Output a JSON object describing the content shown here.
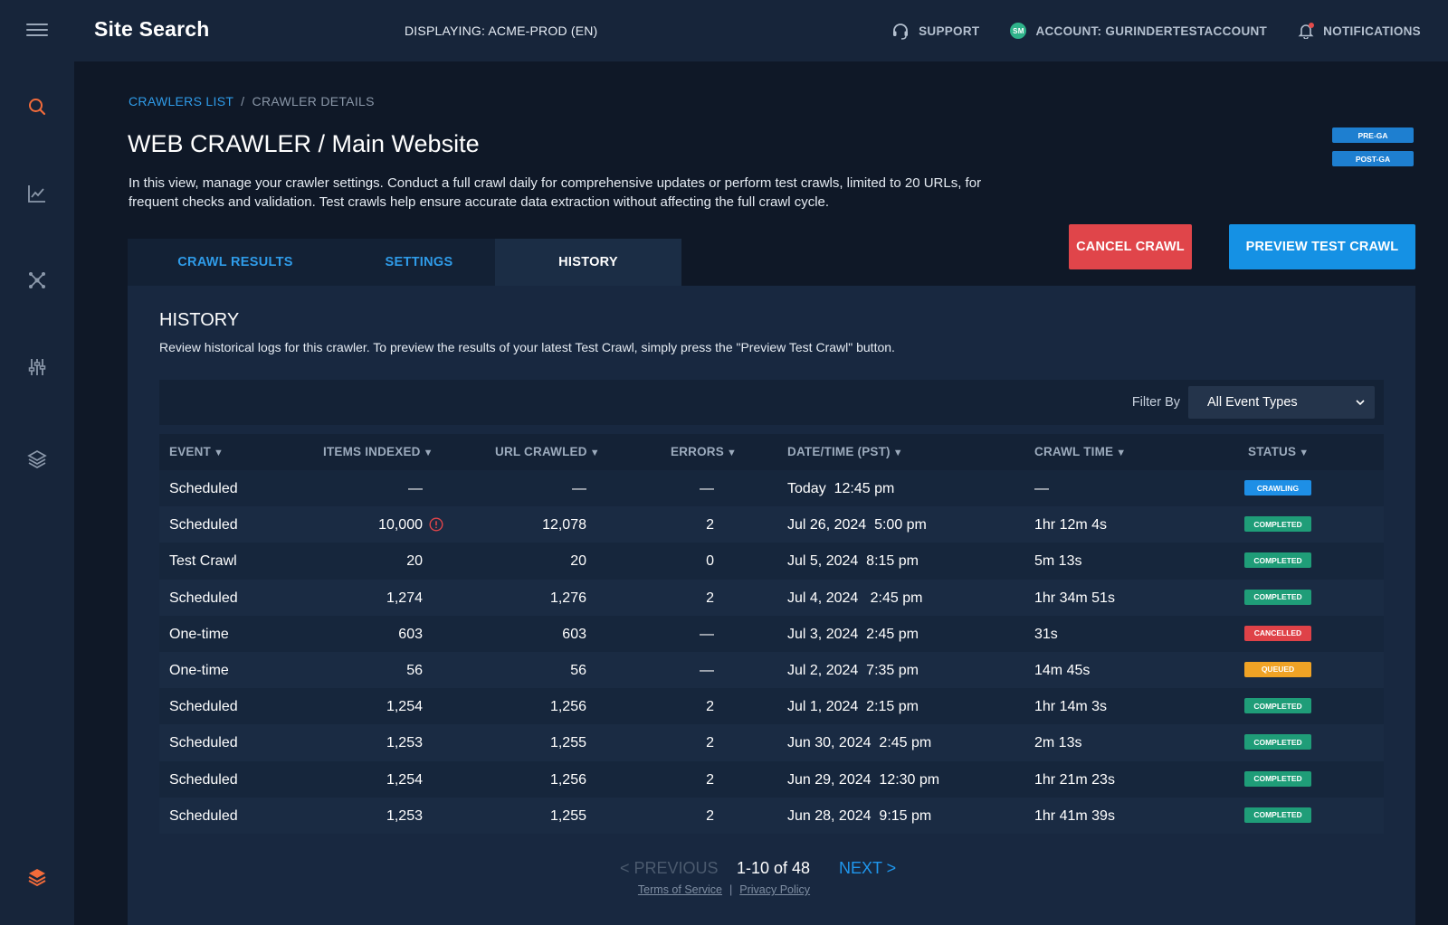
{
  "app": {
    "title": "Site Search",
    "displaying": "DISPLAYING: ACME-PROD (EN)"
  },
  "topnav": {
    "support": "SUPPORT",
    "account_initials": "SM",
    "account": "ACCOUNT: GURINDERTESTACCOUNT",
    "notifications": "NOTIFICATIONS"
  },
  "breadcrumb": {
    "link": "CRAWLERS LIST",
    "sep": "/",
    "current": "CRAWLER DETAILS"
  },
  "page": {
    "title": "WEB CRAWLER / Main Website",
    "description": "In this view, manage your crawler settings. Conduct a full crawl daily for comprehensive updates or perform test crawls, limited to 20 URLs, for frequent checks and validation. Test crawls help ensure accurate data extraction without affecting the full crawl cycle."
  },
  "badges": {
    "pre_ga": "PRE-GA",
    "post_ga": "POST-GA"
  },
  "actions": {
    "cancel": "CANCEL CRAWL",
    "preview": "PREVIEW TEST CRAWL"
  },
  "tabs": [
    {
      "label": "CRAWL RESULTS",
      "active": false
    },
    {
      "label": "SETTINGS",
      "active": false
    },
    {
      "label": "HISTORY",
      "active": true
    }
  ],
  "history": {
    "title": "HISTORY",
    "description": "Review historical logs for this crawler. To preview the results of your latest Test Crawl, simply press the \"Preview Test Crawl\" button.",
    "filter_label": "Filter By",
    "filter_value": "All Event Types"
  },
  "columns": {
    "event": "EVENT",
    "items_indexed": "ITEMS INDEXED",
    "url_crawled": "URL CRAWLED",
    "errors": "ERRORS",
    "datetime": "DATE/TIME (PST)",
    "crawl_time": "CRAWL TIME",
    "status": "STATUS",
    "sort_arrow": "▼"
  },
  "rows": [
    {
      "event": "Scheduled",
      "items": "—",
      "urls": "—",
      "errors": "—",
      "datetime": "Today  12:45 pm",
      "crawl_time": "—",
      "status": "CRAWLING",
      "status_color": "#1e8fe6",
      "warning": false
    },
    {
      "event": "Scheduled",
      "items": "10,000",
      "urls": "12,078",
      "errors": "2",
      "datetime": "Jul 26, 2024  5:00 pm",
      "crawl_time": "1hr 12m 4s",
      "status": "COMPLETED",
      "status_color": "#1f9d78",
      "warning": true
    },
    {
      "event": "Test Crawl",
      "items": "20",
      "urls": "20",
      "errors": "0",
      "datetime": "Jul 5, 2024  8:15 pm",
      "crawl_time": "5m 13s",
      "status": "COMPLETED",
      "status_color": "#1f9d78",
      "warning": false
    },
    {
      "event": "Scheduled",
      "items": "1,274",
      "urls": "1,276",
      "errors": "2",
      "datetime": "Jul 4, 2024   2:45 pm",
      "crawl_time": "1hr 34m 51s",
      "status": "COMPLETED",
      "status_color": "#1f9d78",
      "warning": false
    },
    {
      "event": "One-time",
      "items": "603",
      "urls": "603",
      "errors": "—",
      "datetime": "Jul 3, 2024  2:45 pm",
      "crawl_time": "31s",
      "status": "CANCELLED",
      "status_color": "#df4248",
      "warning": false
    },
    {
      "event": "One-time",
      "items": "56",
      "urls": "56",
      "errors": "—",
      "datetime": "Jul 2, 2024  7:35 pm",
      "crawl_time": "14m 45s",
      "status": "QUEUED",
      "status_color": "#f0a325",
      "warning": false
    },
    {
      "event": "Scheduled",
      "items": "1,254",
      "urls": "1,256",
      "errors": "2",
      "datetime": "Jul 1, 2024  2:15 pm",
      "crawl_time": "1hr 14m 3s",
      "status": "COMPLETED",
      "status_color": "#1f9d78",
      "warning": false
    },
    {
      "event": "Scheduled",
      "items": "1,253",
      "urls": "1,255",
      "errors": "2",
      "datetime": "Jun 30, 2024  2:45 pm",
      "crawl_time": "2m 13s",
      "status": "COMPLETED",
      "status_color": "#1f9d78",
      "warning": false
    },
    {
      "event": "Scheduled",
      "items": "1,254",
      "urls": "1,256",
      "errors": "2",
      "datetime": "Jun 29, 2024  12:30 pm",
      "crawl_time": "1hr 21m 23s",
      "status": "COMPLETED",
      "status_color": "#1f9d78",
      "warning": false
    },
    {
      "event": "Scheduled",
      "items": "1,253",
      "urls": "1,255",
      "errors": "2",
      "datetime": "Jun 28, 2024  9:15 pm",
      "crawl_time": "1hr 41m 39s",
      "status": "COMPLETED",
      "status_color": "#1f9d78",
      "warning": false
    }
  ],
  "pagination": {
    "prev": "< PREVIOUS",
    "count": "1-10 of 48",
    "next": "NEXT >"
  },
  "footer": {
    "terms": "Terms of Service",
    "sep": "|",
    "privacy": "Privacy Policy"
  },
  "colors": {
    "accent": "#1591e4",
    "danger": "#e0454a",
    "success": "#1f9d78",
    "warning": "#f0a325",
    "sidebar_active": "#f26b3a"
  },
  "sidebar": {
    "icons": [
      "search-icon",
      "analytics-icon",
      "crawler-icon",
      "settings-sliders-icon",
      "layers-icon",
      "brand-logo-icon"
    ]
  }
}
